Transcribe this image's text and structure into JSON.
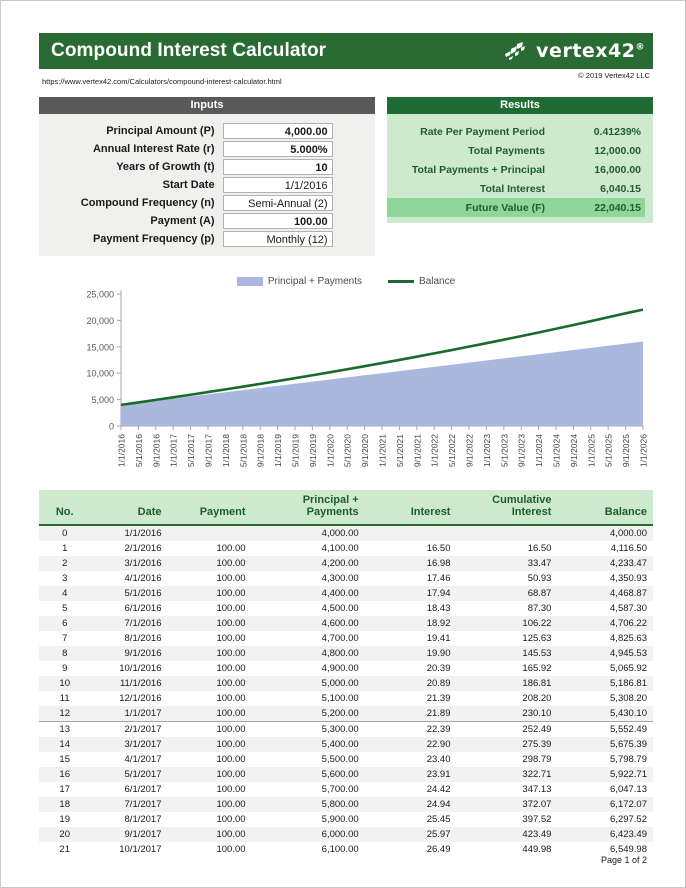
{
  "header": {
    "title": "Compound Interest Calculator",
    "logo_word": "vertex",
    "logo_digits": "42",
    "logo_mark": "vertex42-arrows-icon",
    "url": "https://www.vertex42.com/Calculators/compound-interest-calculator.html",
    "copyright": "© 2019 Vertex42 LLC",
    "banner_color": "#2a6b34"
  },
  "inputs": {
    "heading": "Inputs",
    "heading_bg": "#595959",
    "rows": [
      {
        "label": "Principal Amount (P)",
        "value": "4,000.00",
        "bold": true
      },
      {
        "label": "Annual Interest Rate (r)",
        "value": "5.000%",
        "bold": true
      },
      {
        "label": "Years of Growth (t)",
        "value": "10",
        "bold": true
      },
      {
        "label": "Start Date",
        "value": "1/1/2016",
        "bold": false
      },
      {
        "label": "Compound Frequency (n)",
        "value": "Semi-Annual (2)",
        "bold": false
      },
      {
        "label": "Payment (A)",
        "value": "100.00",
        "bold": true
      },
      {
        "label": "Payment Frequency (p)",
        "value": "Monthly (12)",
        "bold": false
      }
    ]
  },
  "results": {
    "heading": "Results",
    "heading_bg": "#1e6b33",
    "rows": [
      {
        "label": "Rate Per Payment Period",
        "value": "0.41239%"
      },
      {
        "label": "Total Payments",
        "value": "12,000.00"
      },
      {
        "label": "Total Payments + Principal",
        "value": "16,000.00"
      },
      {
        "label": "Total Interest",
        "value": "6,040.15"
      }
    ],
    "final": {
      "label": "Future Value (F)",
      "value": "22,040.15",
      "bg": "#8fd69b"
    }
  },
  "chart_data": {
    "type": "area",
    "title": "",
    "xlabel": "",
    "ylabel": "",
    "ylim": [
      0,
      25000
    ],
    "yticks": [
      "0",
      "5,000",
      "10,000",
      "15,000",
      "20,000",
      "25,000"
    ],
    "ytick_values": [
      0,
      5000,
      10000,
      15000,
      20000,
      25000
    ],
    "grid": false,
    "legend_position": "top-center",
    "legend": [
      {
        "name": "Principal + Payments",
        "color": "#aab8dd",
        "style": "area"
      },
      {
        "name": "Balance",
        "color": "#186b2a",
        "style": "line"
      }
    ],
    "x": [
      "1/1/2016",
      "5/1/2016",
      "9/1/2016",
      "1/1/2017",
      "5/1/2017",
      "9/1/2017",
      "1/1/2018",
      "5/1/2018",
      "9/1/2018",
      "1/1/2019",
      "5/1/2019",
      "9/1/2019",
      "1/1/2020",
      "5/1/2020",
      "9/1/2020",
      "1/1/2021",
      "5/1/2021",
      "9/1/2021",
      "1/1/2022",
      "5/1/2022",
      "9/1/2022",
      "1/1/2023",
      "5/1/2023",
      "9/1/2023",
      "1/1/2024",
      "5/1/2024",
      "9/1/2024",
      "1/1/2025",
      "5/1/2025",
      "9/1/2025",
      "1/1/2026"
    ],
    "series": [
      {
        "name": "Principal + Payments",
        "color": "#aab8dd",
        "style": "area",
        "values": [
          4000,
          4400,
          4800,
          5200,
          5600,
          6000,
          6400,
          6800,
          7200,
          7600,
          8000,
          8400,
          8800,
          9200,
          9600,
          10000,
          10400,
          10800,
          11200,
          11600,
          12000,
          12400,
          12800,
          13200,
          13600,
          14000,
          14400,
          14800,
          15200,
          15600,
          16000
        ]
      },
      {
        "name": "Balance",
        "color": "#186b2a",
        "style": "line",
        "values": [
          4000,
          4469,
          4946,
          5430,
          5922,
          6423,
          6932,
          7450,
          7976,
          8511,
          9055,
          9608,
          10171,
          10743,
          11324,
          11916,
          12517,
          13129,
          13751,
          14384,
          15027,
          15682,
          16348,
          17025,
          17714,
          18415,
          19128,
          19853,
          20590,
          21340,
          22040
        ]
      }
    ]
  },
  "amortization": {
    "columns": [
      "No.",
      "Date",
      "Payment",
      "Principal + Payments",
      "Interest",
      "Cumulative Interest",
      "Balance"
    ],
    "column_header_lines": [
      [
        "No."
      ],
      [
        "Date"
      ],
      [
        "Payment"
      ],
      [
        "Principal +",
        "Payments"
      ],
      [
        "Interest"
      ],
      [
        "Cumulative",
        "Interest"
      ],
      [
        "Balance"
      ]
    ],
    "rows": [
      [
        "0",
        "1/1/2016",
        "",
        "4,000.00",
        "",
        "",
        "4,000.00"
      ],
      [
        "1",
        "2/1/2016",
        "100.00",
        "4,100.00",
        "16.50",
        "16.50",
        "4,116.50"
      ],
      [
        "2",
        "3/1/2016",
        "100.00",
        "4,200.00",
        "16.98",
        "33.47",
        "4,233.47"
      ],
      [
        "3",
        "4/1/2016",
        "100.00",
        "4,300.00",
        "17.46",
        "50.93",
        "4,350.93"
      ],
      [
        "4",
        "5/1/2016",
        "100.00",
        "4,400.00",
        "17.94",
        "68.87",
        "4,468.87"
      ],
      [
        "5",
        "6/1/2016",
        "100.00",
        "4,500.00",
        "18.43",
        "87.30",
        "4,587.30"
      ],
      [
        "6",
        "7/1/2016",
        "100.00",
        "4,600.00",
        "18.92",
        "106.22",
        "4,706.22"
      ],
      [
        "7",
        "8/1/2016",
        "100.00",
        "4,700.00",
        "19.41",
        "125.63",
        "4,825.63"
      ],
      [
        "8",
        "9/1/2016",
        "100.00",
        "4,800.00",
        "19.90",
        "145.53",
        "4,945.53"
      ],
      [
        "9",
        "10/1/2016",
        "100.00",
        "4,900.00",
        "20.39",
        "165.92",
        "5,065.92"
      ],
      [
        "10",
        "11/1/2016",
        "100.00",
        "5,000.00",
        "20.89",
        "186.81",
        "5,186.81"
      ],
      [
        "11",
        "12/1/2016",
        "100.00",
        "5,100.00",
        "21.39",
        "208.20",
        "5,308.20"
      ],
      [
        "12",
        "1/1/2017",
        "100.00",
        "5,200.00",
        "21.89",
        "230.10",
        "5,430.10"
      ],
      [
        "13",
        "2/1/2017",
        "100.00",
        "5,300.00",
        "22.39",
        "252.49",
        "5,552.49"
      ],
      [
        "14",
        "3/1/2017",
        "100.00",
        "5,400.00",
        "22.90",
        "275.39",
        "5,675.39"
      ],
      [
        "15",
        "4/1/2017",
        "100.00",
        "5,500.00",
        "23.40",
        "298.79",
        "5,798.79"
      ],
      [
        "16",
        "5/1/2017",
        "100.00",
        "5,600.00",
        "23.91",
        "322.71",
        "5,922.71"
      ],
      [
        "17",
        "6/1/2017",
        "100.00",
        "5,700.00",
        "24.42",
        "347.13",
        "6,047.13"
      ],
      [
        "18",
        "7/1/2017",
        "100.00",
        "5,800.00",
        "24.94",
        "372.07",
        "6,172.07"
      ],
      [
        "19",
        "8/1/2017",
        "100.00",
        "5,900.00",
        "25.45",
        "397.52",
        "6,297.52"
      ],
      [
        "20",
        "9/1/2017",
        "100.00",
        "6,000.00",
        "25.97",
        "423.49",
        "6,423.49"
      ],
      [
        "21",
        "10/1/2017",
        "100.00",
        "6,100.00",
        "26.49",
        "449.98",
        "6,549.98"
      ]
    ],
    "year_end_rows": [
      12
    ]
  },
  "footer": {
    "page_label": "Page 1 of 2"
  }
}
